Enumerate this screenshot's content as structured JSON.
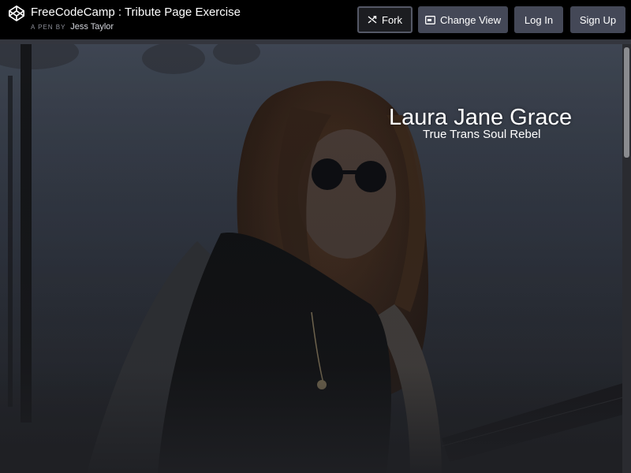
{
  "header": {
    "pen_title": "FreeCodeCamp : Tribute Page Exercise",
    "pen_by": "A PEN BY",
    "author": "Jess Taylor",
    "buttons": {
      "fork": "Fork",
      "change_view": "Change View",
      "log_in": "Log In",
      "sign_up": "Sign Up"
    }
  },
  "preview": {
    "hero_title": "Laura Jane Grace",
    "hero_subtitle": "True Trans Soul Rebel"
  },
  "colors": {
    "header_bg": "#000000",
    "button_bg": "#444857",
    "fork_border": "#555866",
    "text": "#ffffff"
  },
  "icons": {
    "logo": "codepen-logo-icon",
    "fork": "fork-icon",
    "change_view": "change-view-icon"
  }
}
